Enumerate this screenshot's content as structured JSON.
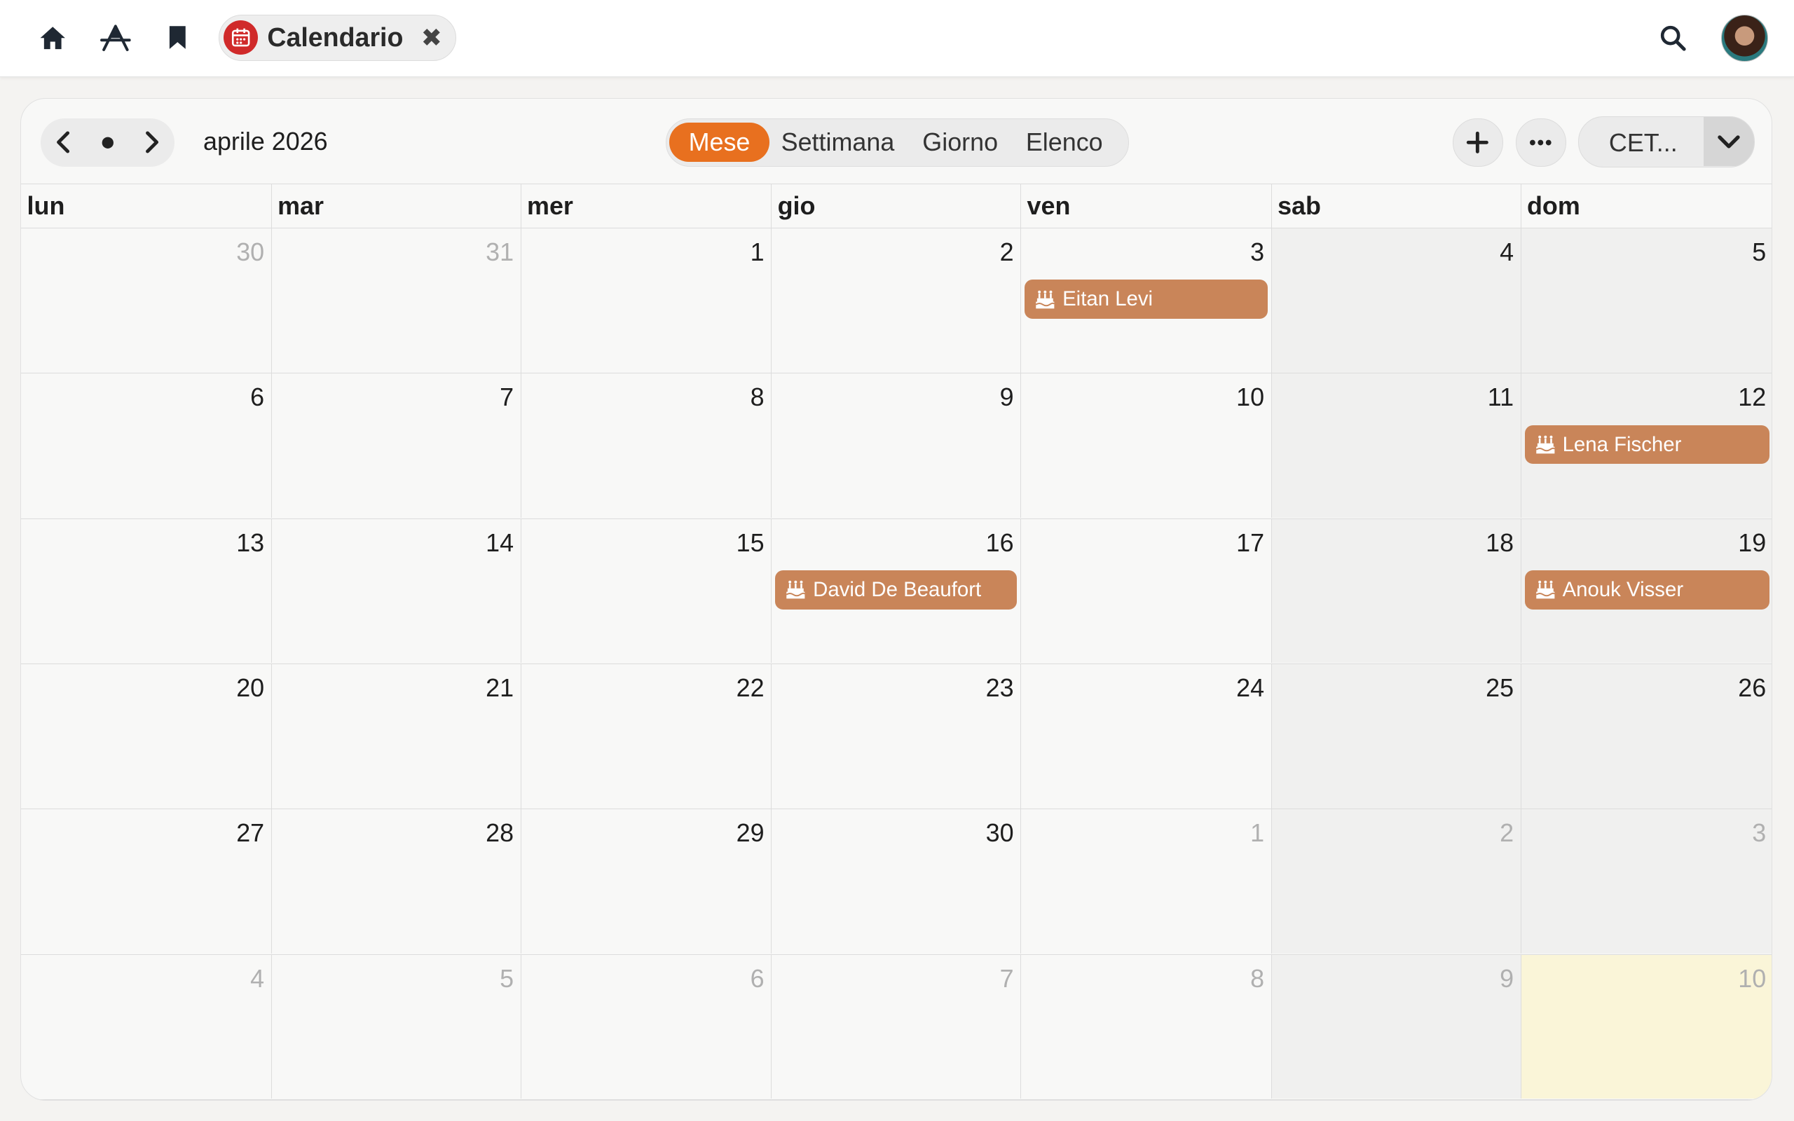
{
  "topbar": {
    "icons": [
      "home-icon",
      "apps-icon",
      "bookmark-icon",
      "search-icon"
    ],
    "app_title": "Calendario",
    "close_symbol": "✖"
  },
  "toolbar": {
    "period_title": "aprile 2026",
    "views": [
      {
        "label": "Mese",
        "active": true
      },
      {
        "label": "Settimana",
        "active": false
      },
      {
        "label": "Giorno",
        "active": false
      },
      {
        "label": "Elenco",
        "active": false
      }
    ],
    "timezone": "CET..."
  },
  "weekday_headers": [
    "lun",
    "mar",
    "mer",
    "gio",
    "ven",
    "sab",
    "dom"
  ],
  "weeks": [
    [
      {
        "day": "30",
        "muted": true
      },
      {
        "day": "31",
        "muted": true
      },
      {
        "day": "1"
      },
      {
        "day": "2"
      },
      {
        "day": "3",
        "event": "Eitan Levi"
      },
      {
        "day": "4"
      },
      {
        "day": "5"
      }
    ],
    [
      {
        "day": "6"
      },
      {
        "day": "7"
      },
      {
        "day": "8"
      },
      {
        "day": "9"
      },
      {
        "day": "10"
      },
      {
        "day": "11"
      },
      {
        "day": "12",
        "event": "Lena Fischer"
      }
    ],
    [
      {
        "day": "13"
      },
      {
        "day": "14"
      },
      {
        "day": "15"
      },
      {
        "day": "16",
        "event": "David De Beaufort"
      },
      {
        "day": "17"
      },
      {
        "day": "18"
      },
      {
        "day": "19",
        "event": "Anouk Visser"
      }
    ],
    [
      {
        "day": "20"
      },
      {
        "day": "21"
      },
      {
        "day": "22"
      },
      {
        "day": "23"
      },
      {
        "day": "24"
      },
      {
        "day": "25"
      },
      {
        "day": "26"
      }
    ],
    [
      {
        "day": "27"
      },
      {
        "day": "28"
      },
      {
        "day": "29"
      },
      {
        "day": "30"
      },
      {
        "day": "1",
        "muted": true
      },
      {
        "day": "2",
        "muted": true
      },
      {
        "day": "3",
        "muted": true
      }
    ],
    [
      {
        "day": "4",
        "muted": true
      },
      {
        "day": "5",
        "muted": true
      },
      {
        "day": "6",
        "muted": true
      },
      {
        "day": "7",
        "muted": true
      },
      {
        "day": "8",
        "muted": true
      },
      {
        "day": "9",
        "muted": true
      },
      {
        "day": "10",
        "muted": true,
        "today": true
      }
    ]
  ],
  "colors": {
    "accent": "#e8701f",
    "event": "#c98559",
    "app_badge": "#d02a2a",
    "today_bg": "#faf5d8"
  }
}
